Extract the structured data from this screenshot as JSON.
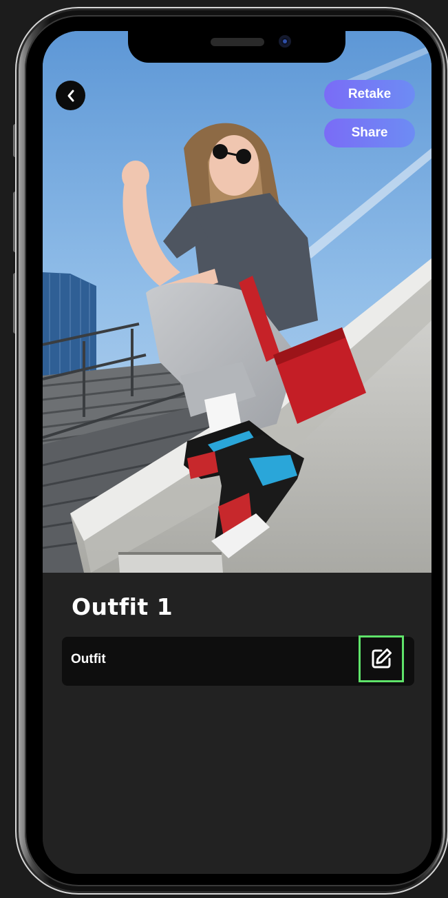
{
  "header": {
    "back_icon": "chevron-left-icon",
    "retake_label": "Retake",
    "share_label": "Share"
  },
  "photo": {
    "description_icon": "outfit-photo"
  },
  "details": {
    "title": "Outfit 1",
    "field_label": "Outfit",
    "edit_icon": "edit-icon"
  },
  "colors": {
    "accent_button": "#7a6cf6",
    "background": "#222222",
    "row_background": "#0e0e0e",
    "highlight_border": "#5fe36a"
  }
}
